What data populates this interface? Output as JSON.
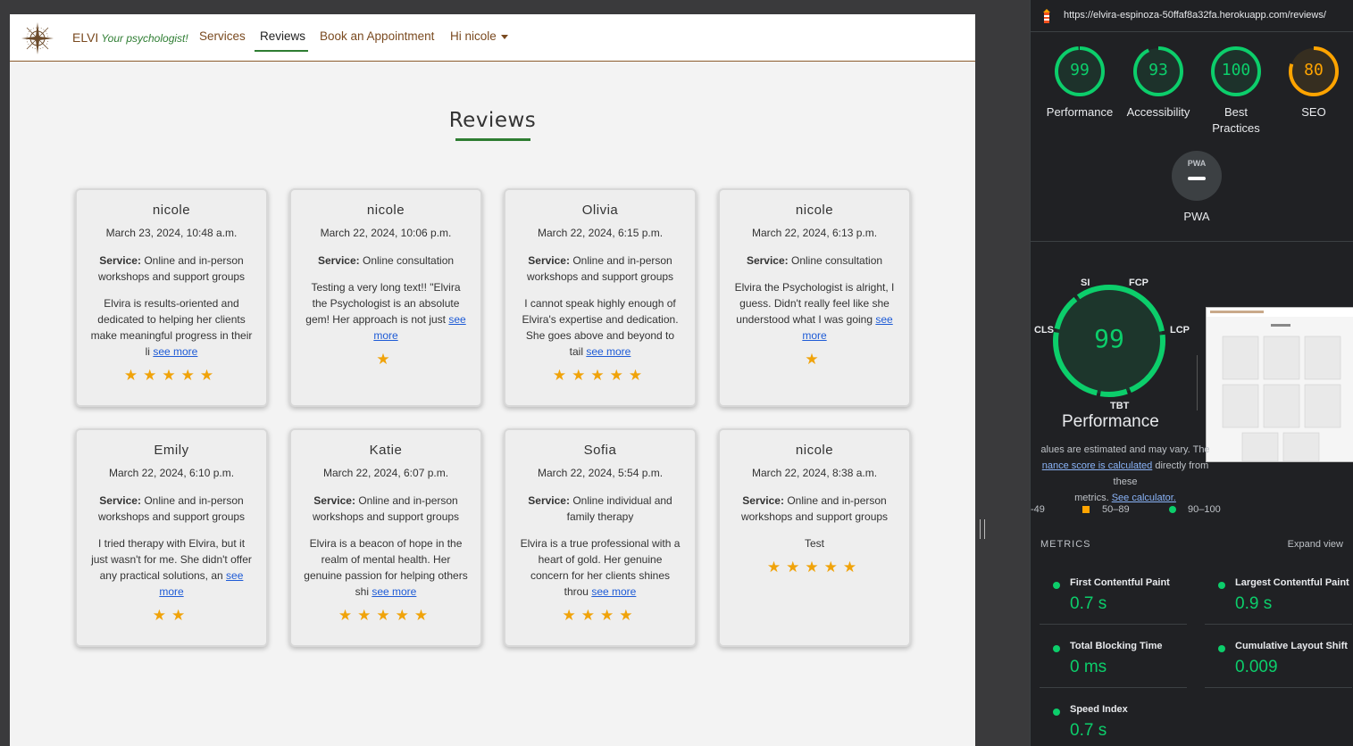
{
  "site": {
    "brand": "ELVI",
    "tagline": "Your psychologist!",
    "nav": {
      "services": "Services",
      "reviews": "Reviews",
      "book": "Book an Appointment",
      "user": "Hi nicole"
    },
    "page_title": "Reviews",
    "see_more": "see more",
    "service_label": "Service:",
    "star_color": "#f0a30a",
    "accent_color": "#2e7d32",
    "reviews": [
      {
        "name": "nicole",
        "date": "March 23, 2024, 10:48 a.m.",
        "service": "Online and in-person workshops and support groups",
        "text": "Elvira is results-oriented and dedicated to helping her clients make meaningful progress in their li",
        "see_more": true,
        "rating": 5
      },
      {
        "name": "nicole",
        "date": "March 22, 2024, 10:06 p.m.",
        "service": "Online consultation",
        "text": "Testing a very long text!! \"Elvira the Psychologist is an absolute gem! Her approach is not just",
        "see_more": true,
        "rating": 1
      },
      {
        "name": "Olivia",
        "date": "March 22, 2024, 6:15 p.m.",
        "service": "Online and in-person workshops and support groups",
        "text": "I cannot speak highly enough of Elvira's expertise and dedication. She goes above and beyond to tail",
        "see_more": true,
        "rating": 5
      },
      {
        "name": "nicole",
        "date": "March 22, 2024, 6:13 p.m.",
        "service": "Online consultation",
        "text": "Elvira the Psychologist is alright, I guess. Didn't really feel like she understood what I was going",
        "see_more": true,
        "rating": 1
      },
      {
        "name": "Emily",
        "date": "March 22, 2024, 6:10 p.m.",
        "service": "Online and in-person workshops and support groups",
        "text": "I tried therapy with Elvira, but it just wasn't for me. She didn't offer any practical solutions, an",
        "see_more": true,
        "rating": 2
      },
      {
        "name": "Katie",
        "date": "March 22, 2024, 6:07 p.m.",
        "service": "Online and in-person workshops and support groups",
        "text": "Elvira is a beacon of hope in the realm of mental health. Her genuine passion for helping others shi",
        "see_more": true,
        "rating": 5
      },
      {
        "name": "Sofia",
        "date": "March 22, 2024, 5:54 p.m.",
        "service": "Online individual and family therapy",
        "text": "Elvira is a true professional with a heart of gold. Her genuine concern for her clients shines throu",
        "see_more": true,
        "rating": 4
      },
      {
        "name": "nicole",
        "date": "March 22, 2024, 8:38 a.m.",
        "service": "Online and in-person workshops and support groups",
        "text": "Test",
        "see_more": false,
        "rating": 5
      }
    ]
  },
  "lighthouse": {
    "url": "https://elvira-espinoza-50ffaf8a32fa.herokuapp.com/reviews/",
    "scores": [
      {
        "label": "Performance",
        "value": 99,
        "color": "#0cce6b"
      },
      {
        "label": "Accessibility",
        "value": 93,
        "color": "#0cce6b"
      },
      {
        "label": "Best Practices",
        "value": 100,
        "color": "#0cce6b"
      },
      {
        "label": "SEO",
        "value": 80,
        "color": "#ffa400"
      }
    ],
    "pwa_label": "PWA",
    "pwa_badge": "PWA",
    "big_score": 99,
    "big_label": "Performance",
    "axis": {
      "si": "SI",
      "fcp": "FCP",
      "lcp": "LCP",
      "tbt": "TBT",
      "cls": "CLS"
    },
    "note_1": "alues are estimated and may vary. The",
    "note_link": "nance score is calculated",
    "note_2": "directly from these",
    "note_3": "metrics.",
    "note_calc": "See calculator.",
    "legend": {
      "low": "-49",
      "mid": "50–89",
      "high": "90–100"
    },
    "metrics_header": "METRICS",
    "expand": "Expand view",
    "metrics": [
      {
        "name": "First Contentful Paint",
        "value": "0.7 s"
      },
      {
        "name": "Largest Contentful Paint",
        "value": "0.9 s"
      },
      {
        "name": "Total Blocking Time",
        "value": "0 ms"
      },
      {
        "name": "Cumulative Layout Shift",
        "value": "0.009"
      },
      {
        "name": "Speed Index",
        "value": "0.7 s"
      }
    ]
  }
}
